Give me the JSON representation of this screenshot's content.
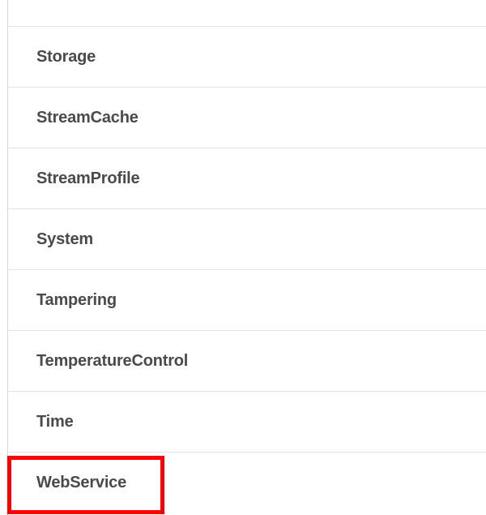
{
  "menu": {
    "items": [
      {
        "label": "Storage"
      },
      {
        "label": "StreamCache"
      },
      {
        "label": "StreamProfile"
      },
      {
        "label": "System"
      },
      {
        "label": "Tampering"
      },
      {
        "label": "TemperatureControl"
      },
      {
        "label": "Time"
      },
      {
        "label": "WebService"
      }
    ],
    "highlighted_item": "WebService",
    "highlight_color": "#ff0000"
  }
}
